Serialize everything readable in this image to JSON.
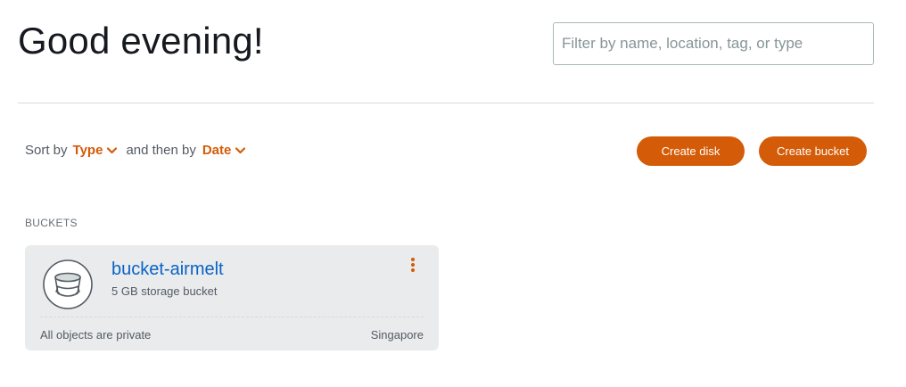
{
  "header": {
    "greeting": "Good evening!",
    "filter_placeholder": "Filter by name, location, tag, or type"
  },
  "sort": {
    "prefix": "Sort by",
    "primary": "Type",
    "middle": "and then by",
    "secondary": "Date"
  },
  "actions": {
    "create_disk": "Create disk",
    "create_bucket": "Create bucket"
  },
  "buckets_section": {
    "label": "BUCKETS",
    "items": [
      {
        "name": "bucket-airmelt",
        "description": "5 GB storage bucket",
        "privacy": "All objects are private",
        "location": "Singapore"
      }
    ]
  },
  "icons": {
    "chevron": "chevron-down-icon",
    "bucket": "bucket-icon",
    "menu": "kebab-menu-icon"
  },
  "colors": {
    "accent": "#d45b07",
    "link": "#0a63c4",
    "card_bg": "#e9ebed"
  }
}
